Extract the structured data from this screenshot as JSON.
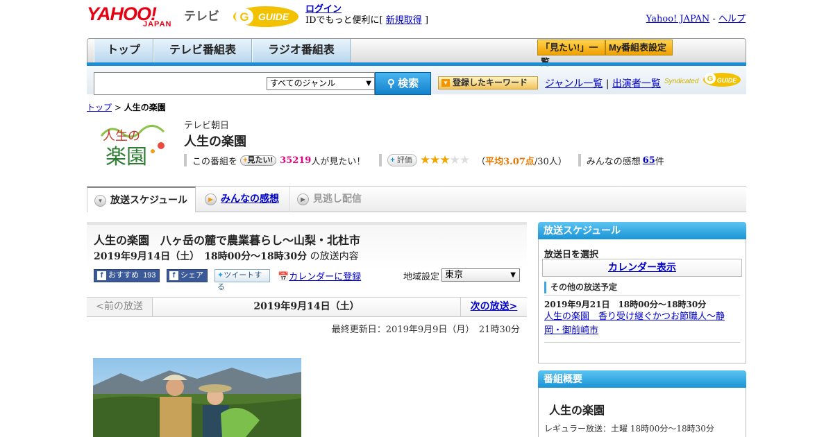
{
  "header": {
    "logo_yahoo": "YAHOO!",
    "logo_japan": "JAPAN",
    "logo_tv": "テレビ",
    "login_link": "ログイン",
    "login_prefix": "IDでもっと便利に[",
    "register_link": "新規取得",
    "login_suffix": "]",
    "yahoo_japan_link": "Yahoo! JAPAN",
    "separator": "-",
    "help_link": "ヘルプ"
  },
  "nav": {
    "tabs": [
      "トップ",
      "テレビ番組表",
      "ラジオ番組表"
    ],
    "mitai_list": "「見たい!」一覧",
    "my_schedule": "My番組表設定"
  },
  "search": {
    "genre_selected": "すべてのジャンル",
    "search_button": "検索",
    "keyword_button": "登録したキーワード",
    "genre_list_link": "ジャンル一覧",
    "link_separator": "|",
    "performer_list_link": "出演者一覧",
    "syndicated": "Syndicated"
  },
  "breadcrumb": {
    "top": "トップ",
    "sep": ">",
    "current": "人生の楽園"
  },
  "program": {
    "logo_text_1": "人生の",
    "logo_text_2": "楽園",
    "channel": "テレビ朝日",
    "title": "人生の楽園",
    "mitai_prefix": "この番組を",
    "mitai_button": "見たい!",
    "mitai_count": "35219",
    "mitai_suffix": "人が見たい！",
    "eval_button": "評価",
    "rating": 3.07,
    "rating_open": "（",
    "rating_avg_label": "平均3.07点",
    "rating_count": "/30人）",
    "impressions_prefix": "みんなの感想",
    "impressions_count": "65",
    "impressions_suffix": "件"
  },
  "tabs": {
    "schedule": "放送スケジュール",
    "impressions": "みんなの感想",
    "streaming": "見逃し配信"
  },
  "episode": {
    "title": "人生の楽園　八ヶ岳の麓で農業暮らし～山梨・北杜市",
    "date_time": "2019年9月14日（土）　18時00分～18時30分",
    "date_suffix": "の放送内容",
    "fb_recommend": "おすすめ",
    "fb_count": "193",
    "fb_share": "シェア",
    "tweet": "ツイートする",
    "calendar": "カレンダーに登録",
    "region_label": "地域設定",
    "region_value": "東京",
    "prev": "<前の放送",
    "current_date": "2019年9月14日（土）",
    "next": "次の放送>",
    "updated": "最終更新日：2019年9月9日（月）　21時30分"
  },
  "sidebar": {
    "schedule_head": "放送スケジュール",
    "select_date": "放送日を選択",
    "calendar_button": "カレンダー表示",
    "other_schedule": "その他の放送予定",
    "next_date": "2019年9月21日　18時00分～18時30分",
    "next_title": "人生の楽園　香り受け継ぐかつお節職人～静岡・御前崎市",
    "overview_head": "番組概要",
    "overview_title": "人生の楽園",
    "regular": "レギュラー放送：土曜 18時00分～18時30分"
  },
  "colors": {
    "brand_red": "#e60012",
    "accent_blue": "#1a8fd6",
    "star": "#f2a500",
    "pink": "#e4007f"
  }
}
